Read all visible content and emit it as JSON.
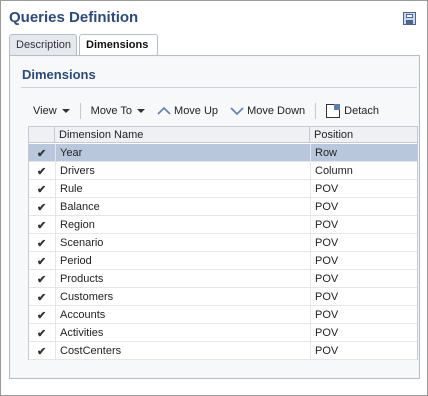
{
  "window": {
    "title": "Queries Definition"
  },
  "icons": {
    "save": "save-icon",
    "detach": "detach-icon",
    "move_up": "arrow-up-icon",
    "move_down": "arrow-down-icon",
    "check": "checkmark-icon"
  },
  "tabs": [
    {
      "label": "Description",
      "selected": false
    },
    {
      "label": "Dimensions",
      "selected": true
    }
  ],
  "section": {
    "title": "Dimensions"
  },
  "toolbar": {
    "view_label": "View",
    "move_to_label": "Move To",
    "move_up_label": "Move Up",
    "move_down_label": "Move Down",
    "detach_label": "Detach"
  },
  "table": {
    "columns": [
      "Dimension Name",
      "Position"
    ],
    "check_glyph": "✔",
    "rows": [
      {
        "name": "Year",
        "position": "Row",
        "checked": true,
        "selected": true
      },
      {
        "name": "Drivers",
        "position": "Column",
        "checked": true
      },
      {
        "name": "Rule",
        "position": "POV",
        "checked": true
      },
      {
        "name": "Balance",
        "position": "POV",
        "checked": true
      },
      {
        "name": "Region",
        "position": "POV",
        "checked": true
      },
      {
        "name": "Scenario",
        "position": "POV",
        "checked": true
      },
      {
        "name": "Period",
        "position": "POV",
        "checked": true
      },
      {
        "name": "Products",
        "position": "POV",
        "checked": true
      },
      {
        "name": "Customers",
        "position": "POV",
        "checked": true
      },
      {
        "name": "Accounts",
        "position": "POV",
        "checked": true
      },
      {
        "name": "Activities",
        "position": "POV",
        "checked": true
      },
      {
        "name": "CostCenters",
        "position": "POV",
        "checked": true
      }
    ]
  },
  "colors": {
    "title": "#2c4a7a",
    "selected_row": "#b9c7dc",
    "accent": "#5f7fb0"
  }
}
